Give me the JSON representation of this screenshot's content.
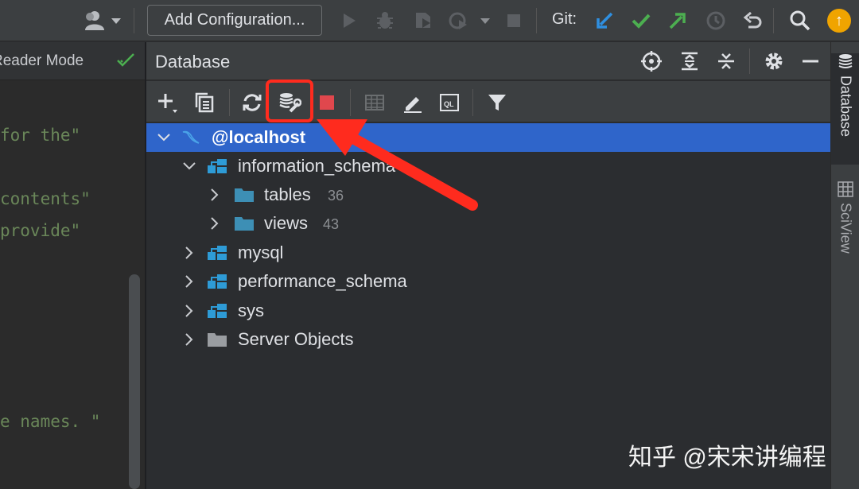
{
  "toolbar": {
    "add_config_label": "Add Configuration...",
    "git_label": "Git:",
    "update_badge": "↑"
  },
  "editor": {
    "reader_mode_label": "Reader Mode",
    "code_lines": [
      "for the\"",
      "contents\"",
      "provide\"",
      "e names. \""
    ]
  },
  "database": {
    "title": "Database",
    "tree": [
      {
        "label": "@localhost",
        "count": "",
        "selected": true
      },
      {
        "label": "information_schema",
        "count": ""
      },
      {
        "label": "tables",
        "count": "36"
      },
      {
        "label": "views",
        "count": "43"
      },
      {
        "label": "mysql",
        "count": ""
      },
      {
        "label": "performance_schema",
        "count": ""
      },
      {
        "label": "sys",
        "count": ""
      },
      {
        "label": "Server Objects",
        "count": ""
      }
    ]
  },
  "right_strip": {
    "database_tab": "Database",
    "sciview_tab": "SciView"
  },
  "colors": {
    "selection": "#2f65ca",
    "highlight": "#ff2b1e",
    "schema_icon": "#2e9bd6",
    "folder_icon": "#3d8fb5",
    "green": "#4caf50",
    "blue_arrow": "#2f8fe0"
  },
  "watermark": "知乎 @宋宋讲编程"
}
